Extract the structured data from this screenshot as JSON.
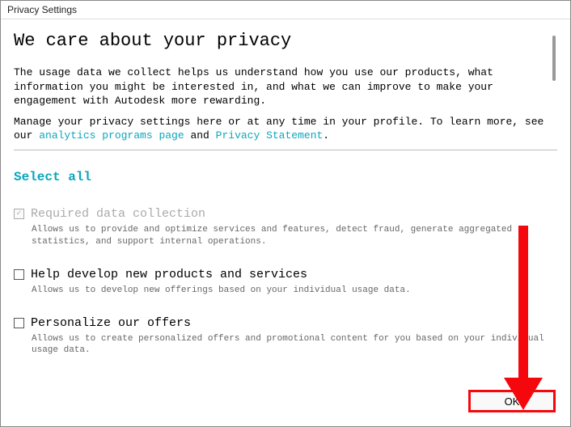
{
  "window": {
    "title": "Privacy Settings"
  },
  "header": {
    "heading": "We care about your privacy"
  },
  "intro": {
    "p1": "The usage data we collect helps us understand how you use our products, what information you might be interested in, and what we can improve to make your engagement with Autodesk more rewarding.",
    "p2_prefix": "Manage your privacy settings here or at any time in your profile. To learn more, see our ",
    "link1": "analytics programs page",
    "p2_mid": " and ",
    "link2": "Privacy Statement",
    "p2_suffix": "."
  },
  "select_all": "Select all",
  "options": {
    "required": {
      "title": "Required data collection",
      "desc": "Allows us to provide and optimize services and features, detect fraud, generate aggregated statistics, and support internal operations.",
      "checked": true,
      "disabled": true
    },
    "develop": {
      "title": "Help develop new products and services",
      "desc": "Allows us to develop new offerings based on your individual usage data.",
      "checked": false
    },
    "personalize": {
      "title": "Personalize our offers",
      "desc": "Allows us to create personalized offers and promotional content for you based on your individual usage data.",
      "checked": false
    }
  },
  "buttons": {
    "ok": "OK"
  }
}
